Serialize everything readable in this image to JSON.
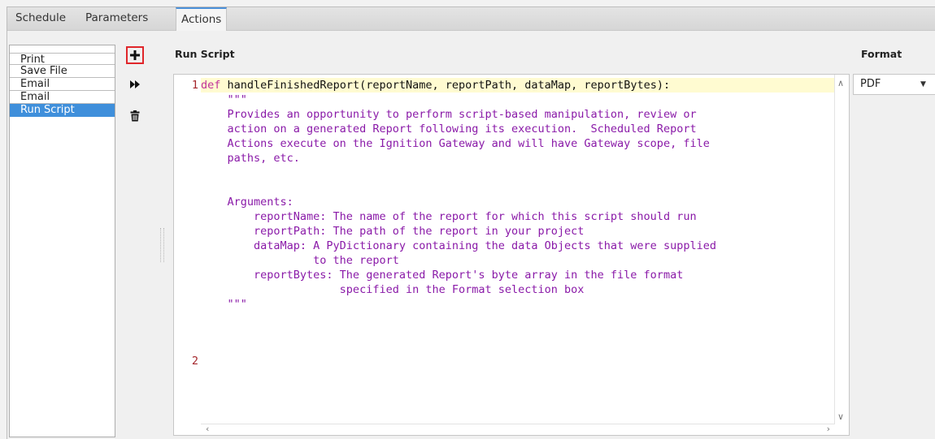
{
  "tabs": [
    {
      "label": "Schedule",
      "active": false
    },
    {
      "label": "Parameters",
      "active": false
    },
    {
      "label": "Actions",
      "active": true
    }
  ],
  "actions": {
    "items": [
      "Print",
      "Save File",
      "Email",
      "Email",
      "Run Script"
    ],
    "selected": "Run Script"
  },
  "toolbar": {
    "add_icon": "plus-icon",
    "run_icon": "fast-forward-icon",
    "delete_icon": "trash-icon"
  },
  "script": {
    "label": "Run Script",
    "line_numbers": [
      "1",
      "2"
    ],
    "def_keyword": "def",
    "signature": "handleFinishedReport(reportName, reportPath, dataMap, reportBytes):",
    "docstring_lines": [
      "    \"\"\"",
      "    Provides an opportunity to perform script-based manipulation, review or",
      "    action on a generated Report following its execution.  Scheduled Report",
      "    Actions execute on the Ignition Gateway and will have Gateway scope, file",
      "    paths, etc.",
      "",
      "    Arguments:",
      "        reportName: The name of the report for which this script should run",
      "        reportPath: The path of the report in your project",
      "        dataMap: A PyDictionary containing the data Objects that were supplied",
      "                 to the report",
      "        reportBytes: The generated Report's byte array in the file format",
      "                     specified in the Format selection box",
      "    \"\"\""
    ]
  },
  "format": {
    "label": "Format",
    "value": "PDF"
  },
  "colors": {
    "accent": "#3f8fdb",
    "highlight_border": "#e0262a",
    "docstring": "#8a1aa8",
    "keyword": "#c0309a",
    "line_number": "#a4262c",
    "current_line": "#fffbd1"
  }
}
